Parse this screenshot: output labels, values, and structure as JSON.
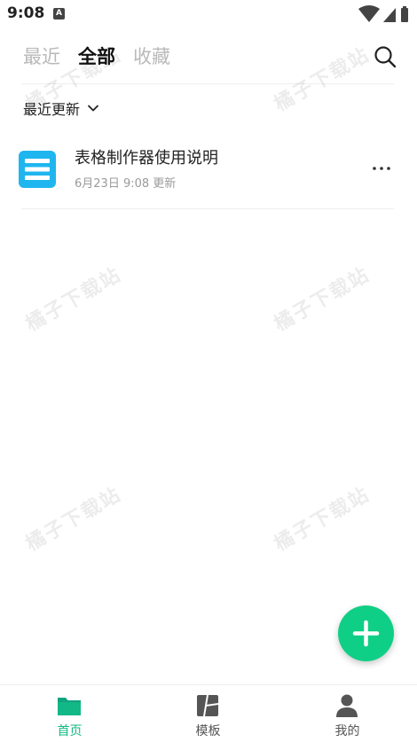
{
  "status_bar": {
    "time": "9:08",
    "notification_badge": "A"
  },
  "tabs": [
    {
      "label": "最近",
      "active": false
    },
    {
      "label": "全部",
      "active": true
    },
    {
      "label": "收藏",
      "active": false
    }
  ],
  "sort": {
    "label": "最近更新"
  },
  "files": [
    {
      "title": "表格制作器使用说明",
      "meta": "6月23日 9:08 更新",
      "icon": "spreadsheet-doc-icon"
    }
  ],
  "watermark": {
    "text": "橘子下载站"
  },
  "fab": {
    "icon": "plus-icon",
    "color": "#0fcf86"
  },
  "bottom_nav": [
    {
      "label": "首页",
      "icon": "folder-icon",
      "active": true
    },
    {
      "label": "模板",
      "icon": "template-icon",
      "active": false
    },
    {
      "label": "我的",
      "icon": "person-icon",
      "active": false
    }
  ],
  "colors": {
    "accent": "#10b981",
    "file_icon": "#1fb6f0",
    "inactive_tab": "#b9b9b9"
  }
}
